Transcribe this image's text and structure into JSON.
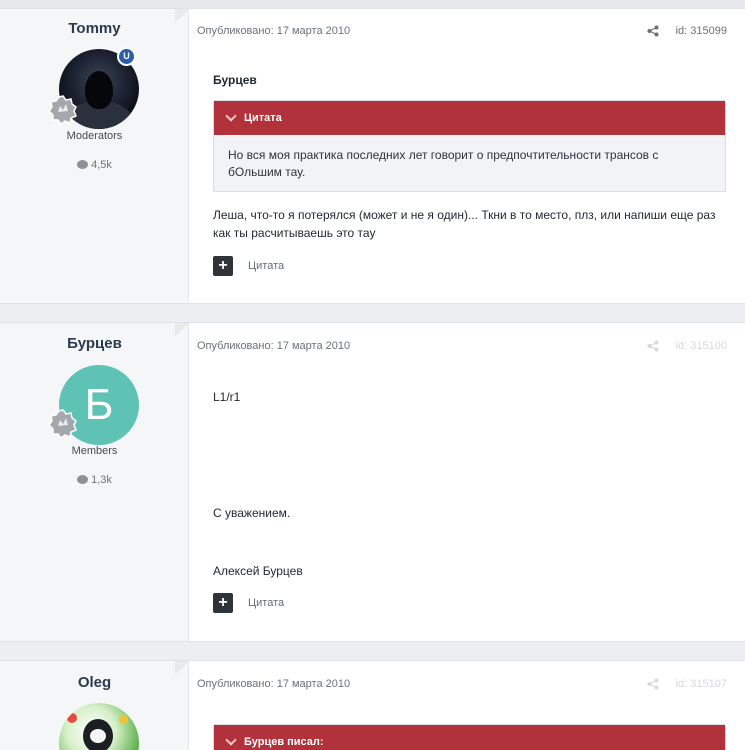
{
  "posts": [
    {
      "author": "Tommy",
      "group": "Moderators",
      "count": "4,5k",
      "badge": "U",
      "published": "Опубликовано: 17 марта 2010",
      "id": "id: 315099",
      "quote_author": "Бурцев",
      "quote_title": "Цитата",
      "quote_text": "Но вся моя практика последних лет говорит о предпочтительности трансов с бОльшим тау.",
      "text": "Леша, что-то я потерялся (может и не я один)... Ткни в то место, плз, или напиши еще раз как ты расчитываешь это тау",
      "quote_button": "+",
      "quote_action": "Цитата"
    },
    {
      "author": "Бурцев",
      "group": "Members",
      "count": "1,3k",
      "avatar_letter": "Б",
      "published": "Опубликовано: 17 марта 2010",
      "id": "id: 315100",
      "line1": "L1/r1",
      "line2": "С уважением.",
      "line3": "Алексей Бурцев",
      "quote_button": "+",
      "quote_action": "Цитата"
    },
    {
      "author": "Oleg",
      "published": "Опубликовано: 17 марта 2010",
      "id": "id: 315107",
      "quote_title": "Бурцев писал:"
    }
  ],
  "icons": {
    "share": "share-icon",
    "comment": "comment-bubble-icon",
    "rank": "rank-badge-icon",
    "chevron": "chevron-down-icon"
  },
  "colors": {
    "quote_header": "#b2323b",
    "avatar_letter_bg": "#5ec3b4",
    "moderator_badge": "#2b5fa8",
    "author_name": "#2b3a4e"
  }
}
